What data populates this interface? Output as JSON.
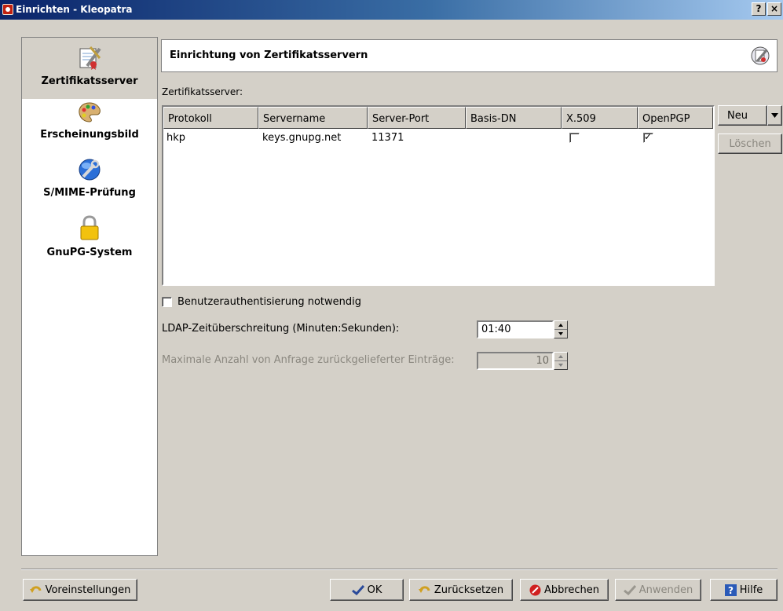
{
  "window": {
    "title": "Einrichten - Kleopatra",
    "help_btn": "?",
    "close_btn": "×"
  },
  "sidebar": {
    "items": [
      {
        "label": "Zertifikatsserver",
        "icon": "certificate-tools-icon"
      },
      {
        "label": "Erscheinungsbild",
        "icon": "palette-icon"
      },
      {
        "label": "S/MIME-Prüfung",
        "icon": "globe-wrench-icon"
      },
      {
        "label": "GnuPG-System",
        "icon": "padlock-icon"
      }
    ]
  },
  "header": {
    "title": "Einrichtung von Zertifikatsservern"
  },
  "servers": {
    "label": "Zertifikatsserver:",
    "columns": [
      "Protokoll",
      "Servername",
      "Server-Port",
      "Basis-DN",
      "X.509",
      "OpenPGP"
    ],
    "rows": [
      {
        "protocol": "hkp",
        "servername": "keys.gnupg.net",
        "port": "11371",
        "basedn": "",
        "x509": false,
        "openpgp": true
      }
    ],
    "new_button": "Neu",
    "delete_button": "Löschen"
  },
  "auth": {
    "label": "Benutzerauthentisierung notwendig",
    "checked": false
  },
  "ldap_timeout": {
    "label": "LDAP-Zeitüberschreitung (Minuten:Sekunden):",
    "value": "01:40"
  },
  "max_entries": {
    "label": "Maximale Anzahl von Anfrage zurückgelieferter Einträge:",
    "value": "10"
  },
  "footer": {
    "defaults": "Voreinstellungen",
    "ok": "OK",
    "reset": "Zurücksetzen",
    "cancel": "Abbrechen",
    "apply": "Anwenden",
    "help": "Hilfe"
  }
}
